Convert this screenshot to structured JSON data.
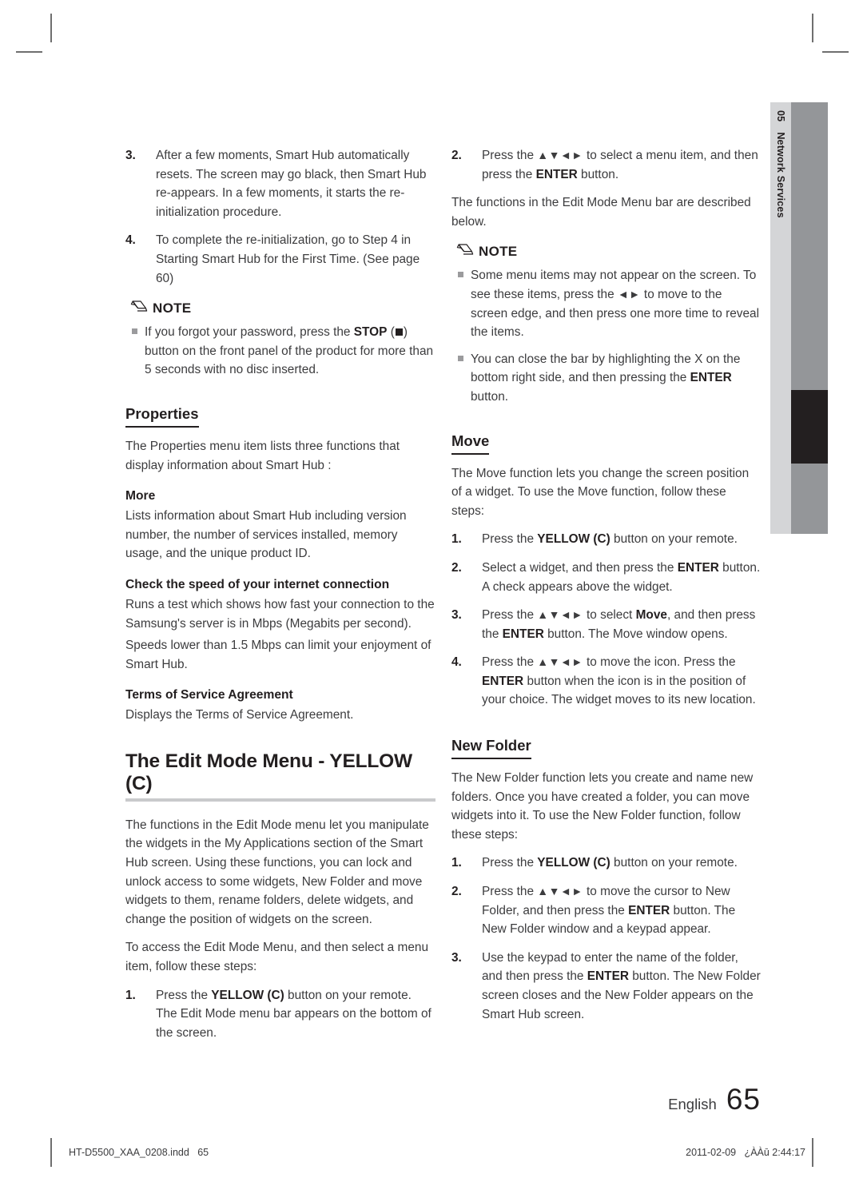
{
  "side_tab": {
    "chapter_number": "05",
    "chapter_name": "Network Services"
  },
  "left_column": {
    "step3": {
      "num": "3.",
      "text": "After a few moments, Smart Hub automatically resets. The screen may go black, then Smart Hub re-appears. In a few moments, it starts the re-initialization procedure."
    },
    "step4": {
      "num": "4.",
      "text": "To complete the re-initialization, go to Step 4 in Starting Smart Hub for the First Time. (See page 60)"
    },
    "note": {
      "label": "NOTE",
      "items": [
        {
          "pre": "If you forgot your password, press the ",
          "bold": "STOP",
          "post_a": " (",
          "icon": "stop-square-icon",
          "post_b": ") button on the front panel of the product for more than 5 seconds with no disc inserted."
        }
      ]
    },
    "properties": {
      "heading": "Properties",
      "intro": "The Properties menu item lists three functions that display information about Smart Hub :",
      "more": {
        "heading": "More",
        "text": "Lists information about Smart Hub including version number, the number of services installed, memory usage, and the unique product ID."
      },
      "speed": {
        "heading": "Check the speed of your internet connection",
        "text_a": "Runs a test which shows how fast your connection to the Samsung's server is in Mbps (Megabits per second).",
        "text_b": "Speeds lower than 1.5 Mbps can limit your enjoyment of Smart Hub."
      },
      "terms": {
        "heading": "Terms of Service Agreement",
        "text": "Displays the Terms of Service Agreement."
      }
    },
    "edit_mode": {
      "heading": "The Edit Mode Menu - YELLOW (C)",
      "para1": "The functions in the Edit Mode menu let you manipulate the widgets in the My Applications section of the Smart Hub screen. Using these functions, you can lock and unlock access to some widgets, New Folder and move widgets to them, rename folders, delete widgets, and change the position of widgets on the screen.",
      "para2": "To access the Edit Mode Menu, and then select a menu item, follow these steps:",
      "step1": {
        "num": "1.",
        "pre": "Press the ",
        "bold": "YELLOW (C)",
        "post": " button on your remote. The Edit Mode menu bar appears on the bottom of the screen."
      }
    }
  },
  "right_column": {
    "step2": {
      "num": "2.",
      "pre": "Press the ",
      "arrows": "▲▼◄►",
      "mid": " to select a menu item, and then press the ",
      "bold": "ENTER",
      "post": " button."
    },
    "intro": "The functions in the Edit Mode Menu bar are described below.",
    "note": {
      "label": "NOTE",
      "item1": {
        "pre": "Some menu items may not appear on the screen. To see these items, press the ",
        "arrows": "◄►",
        "post": " to move to the screen edge, and then press one more time to reveal the items."
      },
      "item2": {
        "pre": "You can close the bar by highlighting the X on the bottom right side, and then pressing the ",
        "bold": "ENTER",
        "post": " button."
      }
    },
    "move": {
      "heading": "Move",
      "intro": "The Move function lets you change the screen position of a widget. To use the Move function, follow these steps:",
      "step1": {
        "num": "1.",
        "pre": "Press the ",
        "bold": "YELLOW (C)",
        "post": " button on your remote."
      },
      "step2": {
        "num": "2.",
        "pre": "Select a widget, and then press the ",
        "bold": "ENTER",
        "post": " button. A check appears above the widget."
      },
      "step3": {
        "num": "3.",
        "pre": "Press the ",
        "arrows": "▲▼◄►",
        "mid_a": " to select ",
        "bold_a": "Move",
        "mid_b": ", and then press the ",
        "bold_b": "ENTER",
        "post": " button. The Move window opens."
      },
      "step4": {
        "num": "4.",
        "pre": "Press the ",
        "arrows": "▲▼◄►",
        "mid": " to move the icon. Press the ",
        "bold": "ENTER",
        "post": " button when the icon is in the position of your choice. The widget moves to its new location."
      }
    },
    "new_folder": {
      "heading": "New Folder",
      "intro": "The New Folder function lets you create and name new folders. Once you have created a folder, you can move widgets into it. To use the New Folder function, follow these steps:",
      "step1": {
        "num": "1.",
        "pre": "Press the ",
        "bold": "YELLOW (C)",
        "post": " button on your remote."
      },
      "step2": {
        "num": "2.",
        "pre": "Press the ",
        "arrows": "▲▼◄►",
        "mid": " to move the cursor to New Folder, and then press the ",
        "bold": "ENTER",
        "post": " button. The New Folder window and a keypad appear."
      },
      "step3": {
        "num": "3.",
        "pre": "Use the keypad to enter the name of the folder, and then press the ",
        "bold": "ENTER",
        "post": " button. The New Folder screen closes and the New Folder appears on the Smart Hub screen."
      }
    }
  },
  "footer": {
    "language": "English",
    "page_number": "65",
    "file_name": "HT-D5500_XAA_0208.indd   65",
    "timestamp": "2011-02-09   ¿ÀÀū 2:44:17"
  },
  "colors": {
    "text": "#3c3c3e",
    "heading": "#231f20",
    "tab_light": "#d4d5d7",
    "tab_dark": "#949699",
    "tab_marker": "#231f20",
    "rule": "#c9cacc"
  }
}
